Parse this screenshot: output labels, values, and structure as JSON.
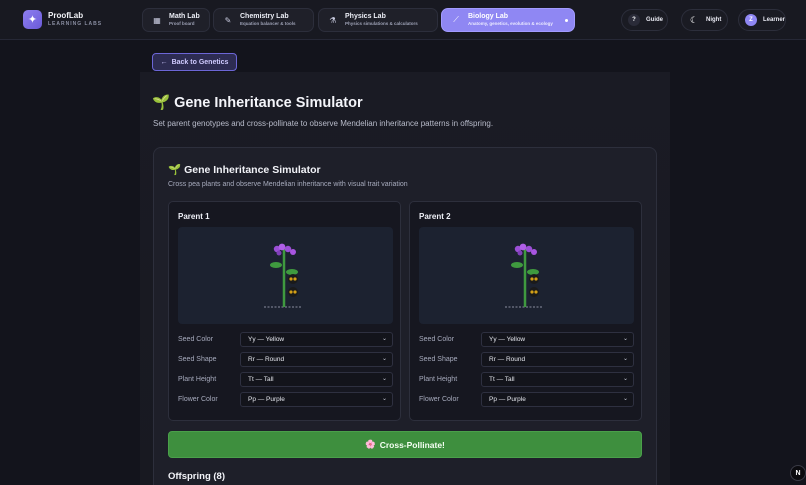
{
  "brand": {
    "icon": "sparkle-icon",
    "title": "ProofLab",
    "subtitle": "LEARNING LABS"
  },
  "nav_tabs": [
    {
      "icon": "abacus-icon",
      "title": "Math Lab",
      "subtitle": "Proof board"
    },
    {
      "icon": "pencil-icon",
      "title": "Chemistry Lab",
      "subtitle": "Equation balancer & tools"
    },
    {
      "icon": "microscope-icon",
      "title": "Physics Lab",
      "subtitle": "Physics simulations & calculators"
    },
    {
      "icon": "dna-icon",
      "title": "Biology Lab",
      "subtitle": "Anatomy, genetics, evolution & ecology",
      "active": true
    }
  ],
  "header_actions": {
    "guide": {
      "icon": "question-icon",
      "label": "Guide"
    },
    "theme": {
      "icon": "moon-icon",
      "label": "Night"
    },
    "user": {
      "avatar_letter": "Z",
      "label": "Learner"
    }
  },
  "back_button": {
    "icon": "arrow-left-icon",
    "label": "Back to Genetics"
  },
  "page": {
    "title_icon": "🌱",
    "title": "Gene Inheritance Simulator",
    "description": "Set parent genotypes and cross-pollinate to observe Mendelian inheritance patterns in offspring."
  },
  "simulator": {
    "title_icon": "🌱",
    "title": "Gene Inheritance Simulator",
    "description": "Cross pea plants and observe Mendelian inheritance with visual trait variation",
    "parents": [
      {
        "label": "Parent 1",
        "traits": [
          {
            "name": "Seed Color",
            "value": "Yy — Yellow"
          },
          {
            "name": "Seed Shape",
            "value": "Rr — Round"
          },
          {
            "name": "Plant Height",
            "value": "Tt — Tall"
          },
          {
            "name": "Flower Color",
            "value": "Pp — Purple"
          }
        ]
      },
      {
        "label": "Parent 2",
        "traits": [
          {
            "name": "Seed Color",
            "value": "Yy — Yellow"
          },
          {
            "name": "Seed Shape",
            "value": "Rr — Round"
          },
          {
            "name": "Plant Height",
            "value": "Tt — Tall"
          },
          {
            "name": "Flower Color",
            "value": "Pp — Purple"
          }
        ]
      }
    ],
    "cross_button": {
      "icon": "🌸",
      "label": "Cross-Pollinate!"
    },
    "offspring_label": "Offspring (8)"
  },
  "colors": {
    "accent": "#8f87f3",
    "cross_button": "#3e8f3e",
    "flower": "#9b4fd6",
    "seed_pod": "#d4a017",
    "stem": "#3f9a3f"
  },
  "corner_badge": "N"
}
